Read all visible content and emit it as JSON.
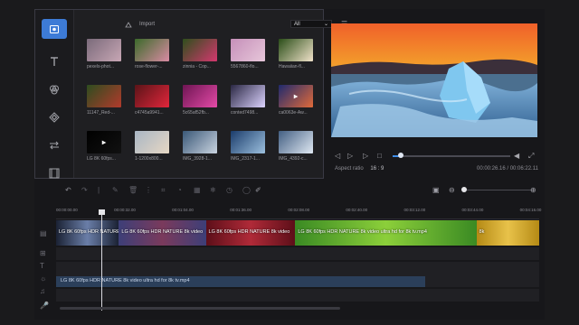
{
  "media": {
    "import_label": "Import",
    "filter_value": "All",
    "items": [
      {
        "label": "pexels-phot...",
        "colors": [
          "#7a6a7a",
          "#c8a7b5"
        ],
        "video": false
      },
      {
        "label": "rose-flower-...",
        "colors": [
          "#3b6a2a",
          "#d98ba3"
        ],
        "video": false
      },
      {
        "label": "zinnia - Cop...",
        "colors": [
          "#2e4f1c",
          "#d4386f"
        ],
        "video": false
      },
      {
        "label": "5567860-flo...",
        "colors": [
          "#c58fb9",
          "#e7c7da"
        ],
        "video": false
      },
      {
        "label": "Hawaiian-fl...",
        "colors": [
          "#2a4d18",
          "#f0e2c9"
        ],
        "video": false
      },
      {
        "label": "11147_Red-...",
        "colors": [
          "#2d4d1f",
          "#b23a2c"
        ],
        "video": false
      },
      {
        "label": "c4745a9941...",
        "colors": [
          "#5a1418",
          "#e2263b"
        ],
        "video": false
      },
      {
        "label": "5c65af52fb...",
        "colors": [
          "#6e1553",
          "#e44aa7"
        ],
        "video": false
      },
      {
        "label": "conted7498...",
        "colors": [
          "#2a2743",
          "#dcd3ff"
        ],
        "video": false
      },
      {
        "label": "ca0063e-Aw...",
        "colors": [
          "#1f2a6e",
          "#e06a3a"
        ],
        "video": true
      },
      {
        "label": "LG 8K 60fps...",
        "colors": [
          "#000000",
          "#111111"
        ],
        "video": true
      },
      {
        "label": "1-1200x800...",
        "colors": [
          "#a9b6c4",
          "#e6d7c4"
        ],
        "video": false
      },
      {
        "label": "IMG_3928-1...",
        "colors": [
          "#3a5878",
          "#c9d3df"
        ],
        "video": false
      },
      {
        "label": "IMG_2317-1...",
        "colors": [
          "#1b3c6b",
          "#9cc0de"
        ],
        "video": false
      },
      {
        "label": "IMG_4392-c...",
        "colors": [
          "#435f83",
          "#dfe8f2"
        ],
        "video": false
      }
    ]
  },
  "player": {
    "aspect_label": "Aspect ratio",
    "aspect_value": "16 : 9",
    "time_text": "00:00:26.16 / 00:06:22.11",
    "progress": 0.07
  },
  "timeline": {
    "ruler": [
      {
        "t": "00:00:00.00",
        "p": 0.0
      },
      {
        "t": "00:00:32.00",
        "p": 0.12
      },
      {
        "t": "00:01:04.00",
        "p": 0.24
      },
      {
        "t": "00:01:36.00",
        "p": 0.36
      },
      {
        "t": "00:02:08.00",
        "p": 0.48
      },
      {
        "t": "00:02:40.00",
        "p": 0.6
      },
      {
        "t": "00:03:12.00",
        "p": 0.72
      },
      {
        "t": "00:03:44.00",
        "p": 0.84
      },
      {
        "t": "00:04:16.00",
        "p": 0.96
      }
    ],
    "clips": [
      {
        "label": "LG 8K 60fps HDR NATURE",
        "w": 0.13,
        "c": [
          "#1b2234",
          "#6a7ea8"
        ]
      },
      {
        "label": "LG 8K 60fps HDR NATURE 8k video",
        "w": 0.18,
        "c": [
          "#3d3f78",
          "#7a3a5c"
        ]
      },
      {
        "label": "LG 8K 60fps HDR NATURE 8k video",
        "w": 0.185,
        "c": [
          "#5d0f19",
          "#b02a38"
        ]
      },
      {
        "label": "LG 8K 60fps HDR NATURE 8k video ultra hd for 8k tv.mp4",
        "w": 0.375,
        "c": [
          "#3a8a23",
          "#8ccf3a"
        ]
      },
      {
        "label": "8k",
        "w": 0.13,
        "c": [
          "#b58a15",
          "#e8c24a"
        ]
      }
    ],
    "audio_label": "LG 8K 60fps HDR NATURE 8k video ultra hd for 8k tv.mp4"
  },
  "colors": {
    "accent": "#3d7bd6",
    "audio_clip": "#2b3f5a"
  }
}
